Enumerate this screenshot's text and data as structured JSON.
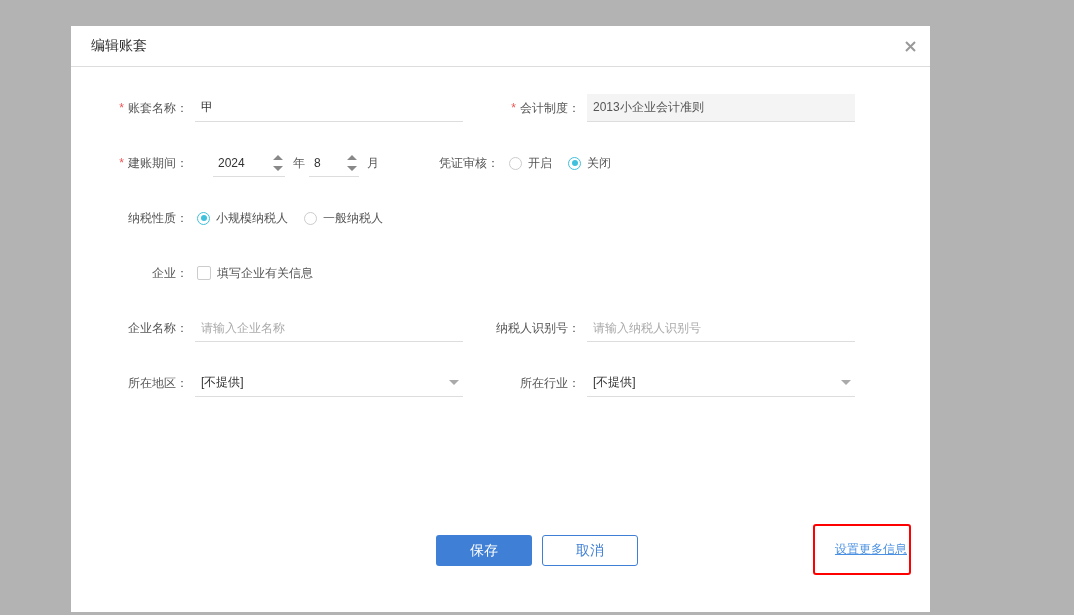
{
  "dialog": {
    "title": "编辑账套"
  },
  "account_name": {
    "required_mark": "*",
    "label": "账套名称：",
    "value": "甲"
  },
  "accounting_standard": {
    "required_mark": "*",
    "label": "会计制度：",
    "value": "2013小企业会计准则",
    "disabled": true
  },
  "period": {
    "required_mark": "*",
    "label": "建账期间：",
    "year": "2024",
    "year_unit": "年",
    "month": "8",
    "month_unit": "月"
  },
  "voucher_review": {
    "label": "凭证审核：",
    "options": [
      {
        "label": "开启",
        "selected": false
      },
      {
        "label": "关闭",
        "selected": true
      }
    ]
  },
  "taxpayer_type": {
    "label": "纳税性质：",
    "options": [
      {
        "label": "小规模纳税人",
        "selected": true
      },
      {
        "label": "一般纳税人",
        "selected": false
      }
    ]
  },
  "enterprise": {
    "label": "企业：",
    "checkbox_label": "填写企业有关信息",
    "checked": false
  },
  "company_name": {
    "label": "企业名称：",
    "placeholder": "请输入企业名称"
  },
  "taxpayer_id": {
    "label": "纳税人识别号：",
    "placeholder": "请输入纳税人识别号"
  },
  "region": {
    "label": "所在地区：",
    "value": "[不提供]"
  },
  "industry": {
    "label": "所在行业：",
    "value": "[不提供]"
  },
  "buttons": [
    {
      "label": "保存",
      "kind": "primary"
    },
    {
      "label": "取消",
      "kind": "secondary"
    }
  ],
  "more_link": {
    "label": "设置更多信息",
    "highlighted": true
  }
}
